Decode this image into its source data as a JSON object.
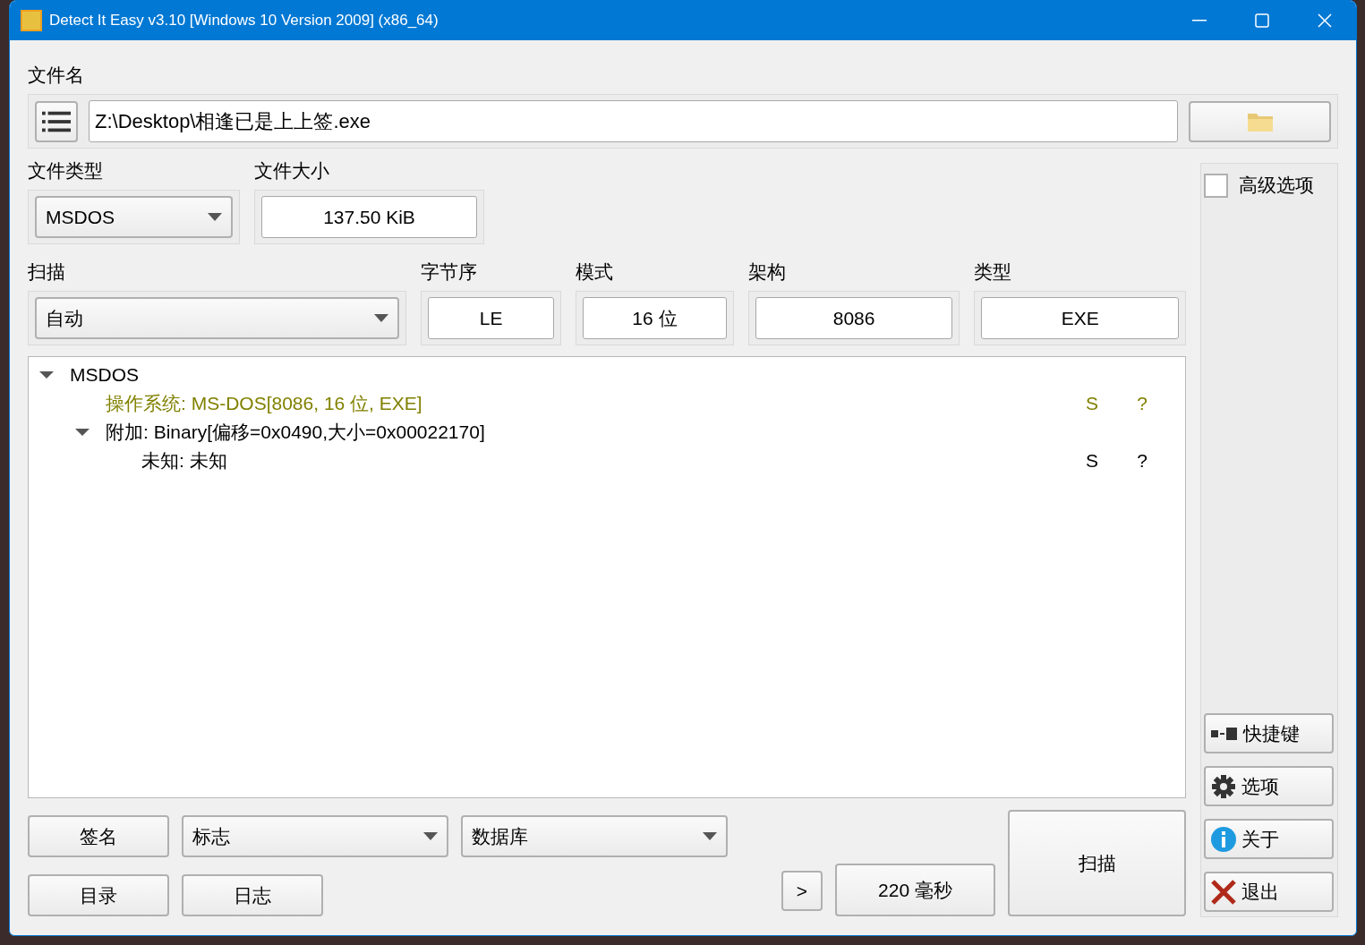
{
  "window": {
    "title": "Detect It Easy v3.10 [Windows 10 Version 2009] (x86_64)"
  },
  "file_name": {
    "label": "文件名",
    "value": "Z:\\Desktop\\相逢已是上上签.exe"
  },
  "file_type": {
    "label": "文件类型",
    "value": "MSDOS"
  },
  "file_size": {
    "label": "文件大小",
    "value": "137.50 KiB"
  },
  "scan": {
    "label": "扫描",
    "value": "自动"
  },
  "info_fields": [
    {
      "label": "字节序",
      "value": "LE"
    },
    {
      "label": "模式",
      "value": "16 位"
    },
    {
      "label": "架构",
      "value": "8086"
    },
    {
      "label": "类型",
      "value": "EXE"
    }
  ],
  "tree": [
    {
      "label": "MSDOS",
      "expanded": true,
      "color": "#000000",
      "children": [
        {
          "label": "操作系统: MS-DOS[8086, 16 位, EXE]",
          "color": "#808000",
          "column_2": "S",
          "column_3": "?"
        },
        {
          "label": "附加: Binary[偏移=0x0490,大小=0x00022170]",
          "expanded": true,
          "color": "#000000",
          "children": [
            {
              "label": "未知: 未知",
              "color": "#000000",
              "column_2": "S",
              "column_3": "?"
            }
          ]
        }
      ]
    }
  ],
  "advanced": {
    "label": "高级选项",
    "checked": false
  },
  "side_buttons": [
    {
      "label": "快捷键",
      "kind": "shortcuts"
    },
    {
      "label": "选项",
      "kind": "options"
    },
    {
      "label": "关于",
      "kind": "about"
    },
    {
      "label": "退出",
      "kind": "exit"
    }
  ],
  "bottom": {
    "signature": "签名",
    "flags": "标志",
    "database": "数据库",
    "directory": "目录",
    "log": "日志",
    "more": ">",
    "time": "220 毫秒",
    "scan_button": "扫描"
  }
}
